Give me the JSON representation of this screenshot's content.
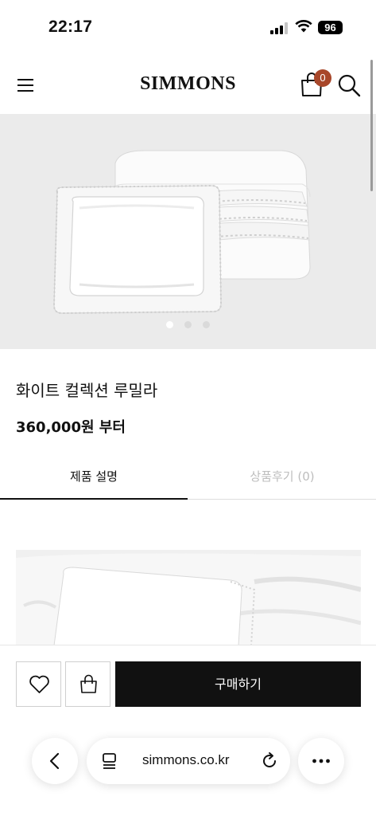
{
  "status": {
    "time": "22:17",
    "battery": "96"
  },
  "header": {
    "logo": "SIMMONS",
    "cart_count": "0"
  },
  "product": {
    "title": "화이트 컬렉션 루밀라",
    "price": "360,000원 부터"
  },
  "tabs": [
    {
      "label": "제품 설명"
    },
    {
      "label": "상품후기 (0)"
    }
  ],
  "actions": {
    "buy_label": "구매하기"
  },
  "browser": {
    "url": "simmons.co.kr"
  },
  "carousel": {
    "slides": 3,
    "active_index": 0
  }
}
